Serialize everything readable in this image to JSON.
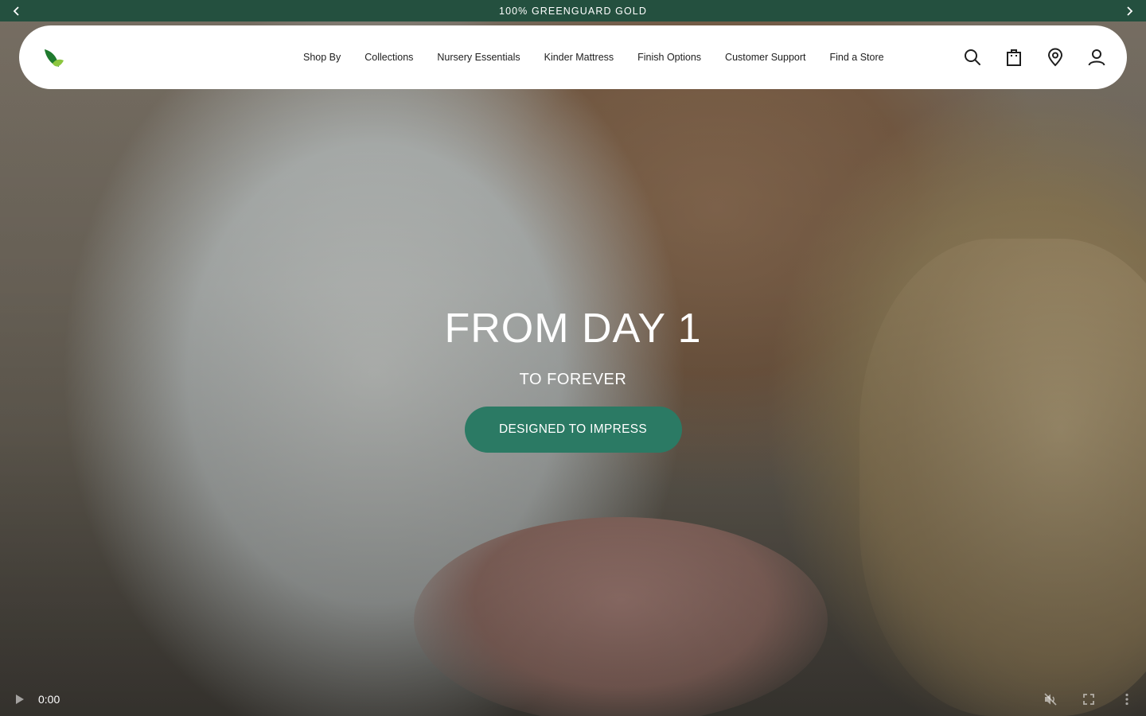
{
  "announcement": {
    "message": "100% GREENGUARD GOLD",
    "prev_icon": "chevron-left-icon",
    "next_icon": "chevron-right-icon"
  },
  "header": {
    "logo_icon": "leaf-logo-icon",
    "nav": [
      {
        "label": "Shop By"
      },
      {
        "label": "Collections"
      },
      {
        "label": "Nursery Essentials"
      },
      {
        "label": "Kinder Mattress"
      },
      {
        "label": "Finish Options"
      },
      {
        "label": "Customer Support"
      },
      {
        "label": "Find a Store"
      }
    ],
    "icons": [
      "search-icon",
      "shopping-bag-icon",
      "location-pin-icon",
      "account-icon"
    ]
  },
  "hero": {
    "title": "FROM DAY 1",
    "subtitle": "TO FOREVER",
    "cta_label": "DESIGNED TO IMPRESS"
  },
  "video_controls": {
    "time": "0:00",
    "icons": [
      "play-icon",
      "muted-icon",
      "fullscreen-icon",
      "more-options-icon"
    ]
  },
  "colors": {
    "announcement_bg": "#24503f",
    "cta_bg": "#2b7a64",
    "logo_green_dark": "#1f7a2e",
    "logo_green_light": "#8cc63f"
  }
}
